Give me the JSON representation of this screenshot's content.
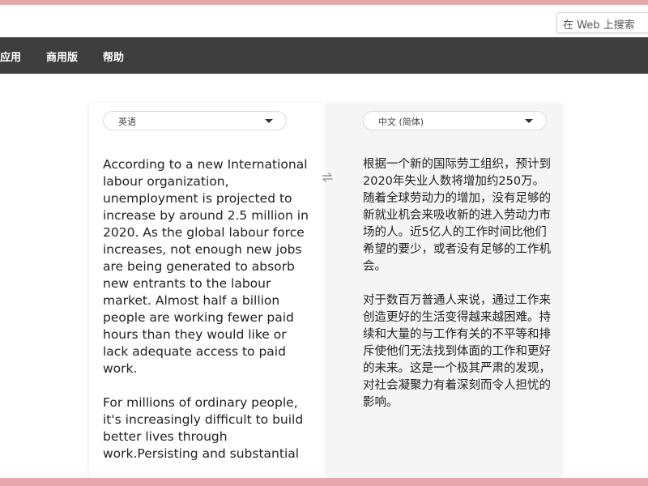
{
  "search": {
    "label": "在 Web 上搜索"
  },
  "nav": {
    "items": [
      {
        "label": "应用"
      },
      {
        "label": "商用版"
      },
      {
        "label": "帮助"
      }
    ]
  },
  "source": {
    "language": "英语",
    "paragraphs": [
      "According to a new International labour organization, unemployment is projected to increase by around 2.5 million in 2020. As the global labour force increases, not enough new jobs are being generated to absorb new entrants to the labour market. Almost half a billion people are working fewer paid hours than they would like or lack adequate access to paid work.",
      "For millions of ordinary people, it's increasingly difficult to build better lives through work.Persisting and substantial"
    ]
  },
  "target": {
    "language": "中文 (简体)",
    "paragraphs": [
      "根据一个新的国际劳工组织，预计到2020年失业人数将增加约250万。随着全球劳动力的增加，没有足够的新就业机会来吸收新的进入劳动力市场的人。近5亿人的工作时间比他们希望的要少，或者没有足够的工作机会。",
      "对于数百万普通人来说，通过工作来创造更好的生活变得越来越困难。持续和大量的与工作有关的不平等和排斥使他们无法找到体面的工作和更好的未来。这是一个极其严肃的发现，对社会凝聚力有着深刻而令人担忧的影响。"
    ]
  },
  "colors": {
    "nav_bg": "#3e3e3e",
    "accent_stripe": "#e8a7aa",
    "target_panel_bg": "#f5f5f5"
  },
  "icons": {
    "swap": "swap-arrows-icon",
    "dropdown": "chevron-down-icon"
  }
}
